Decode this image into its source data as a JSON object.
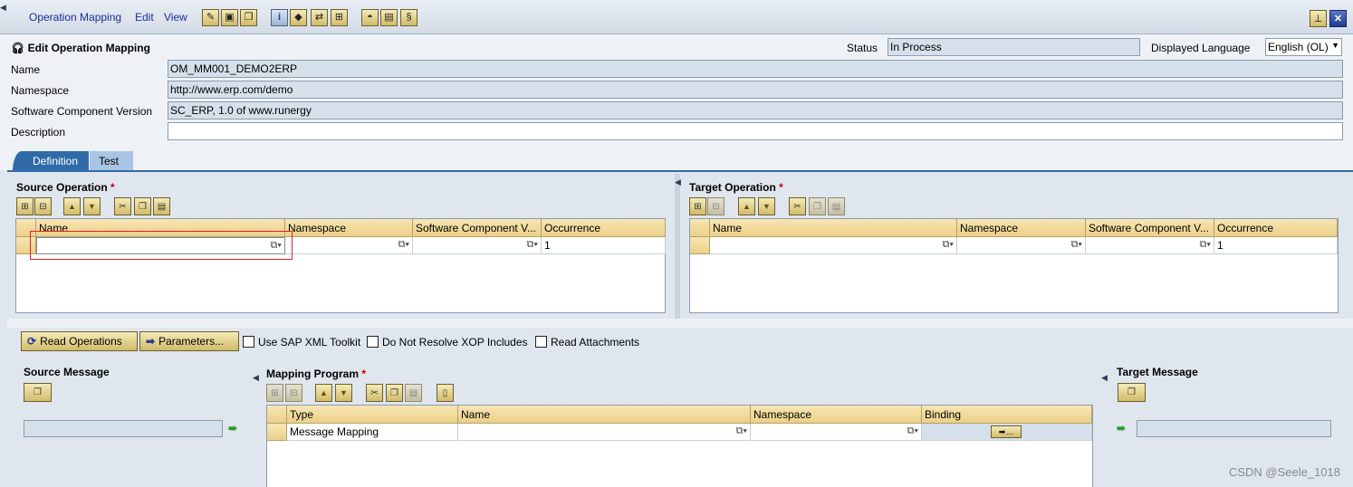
{
  "menu": {
    "operation_mapping": "Operation Mapping",
    "edit": "Edit",
    "view": "View"
  },
  "header": {
    "title": "Edit Operation Mapping",
    "status_label": "Status",
    "status_value": "In Process",
    "language_label": "Displayed Language",
    "language_value": "English (OL)",
    "name_label": "Name",
    "name_value": "OM_MM001_DEMO2ERP",
    "namespace_label": "Namespace",
    "namespace_value": "http://www.erp.com/demo",
    "swcv_label": "Software Component Version",
    "swcv_value": "SC_ERP, 1.0 of www.runergy",
    "description_label": "Description",
    "description_value": ""
  },
  "tabs": {
    "definition": "Definition",
    "test": "Test"
  },
  "source_operation": {
    "title": "Source Operation",
    "required_mark": "*",
    "columns": [
      "Name",
      "Namespace",
      "Software Component V...",
      "Occurrence"
    ],
    "row": {
      "name": "",
      "namespace": "",
      "swcv": "",
      "occurrence": "1"
    }
  },
  "target_operation": {
    "title": "Target Operation",
    "required_mark": "*",
    "columns": [
      "Name",
      "Namespace",
      "Software Component V...",
      "Occurrence"
    ],
    "row": {
      "name": "",
      "namespace": "",
      "swcv": "",
      "occurrence": "1"
    }
  },
  "actions": {
    "read_operations": "Read Operations",
    "parameters": "Parameters...",
    "use_sap_xml_toolkit": "Use SAP XML Toolkit",
    "do_not_resolve_xop": "Do Not Resolve XOP Includes",
    "read_attachments": "Read Attachments"
  },
  "source_message": {
    "title": "Source Message"
  },
  "target_message": {
    "title": "Target Message"
  },
  "mapping_program": {
    "title": "Mapping Program",
    "required_mark": "*",
    "columns": [
      "Type",
      "Name",
      "Namespace",
      "Binding"
    ],
    "row": {
      "type": "Message Mapping",
      "name": "",
      "namespace": ""
    }
  },
  "watermark": "CSDN @Seele_1018"
}
